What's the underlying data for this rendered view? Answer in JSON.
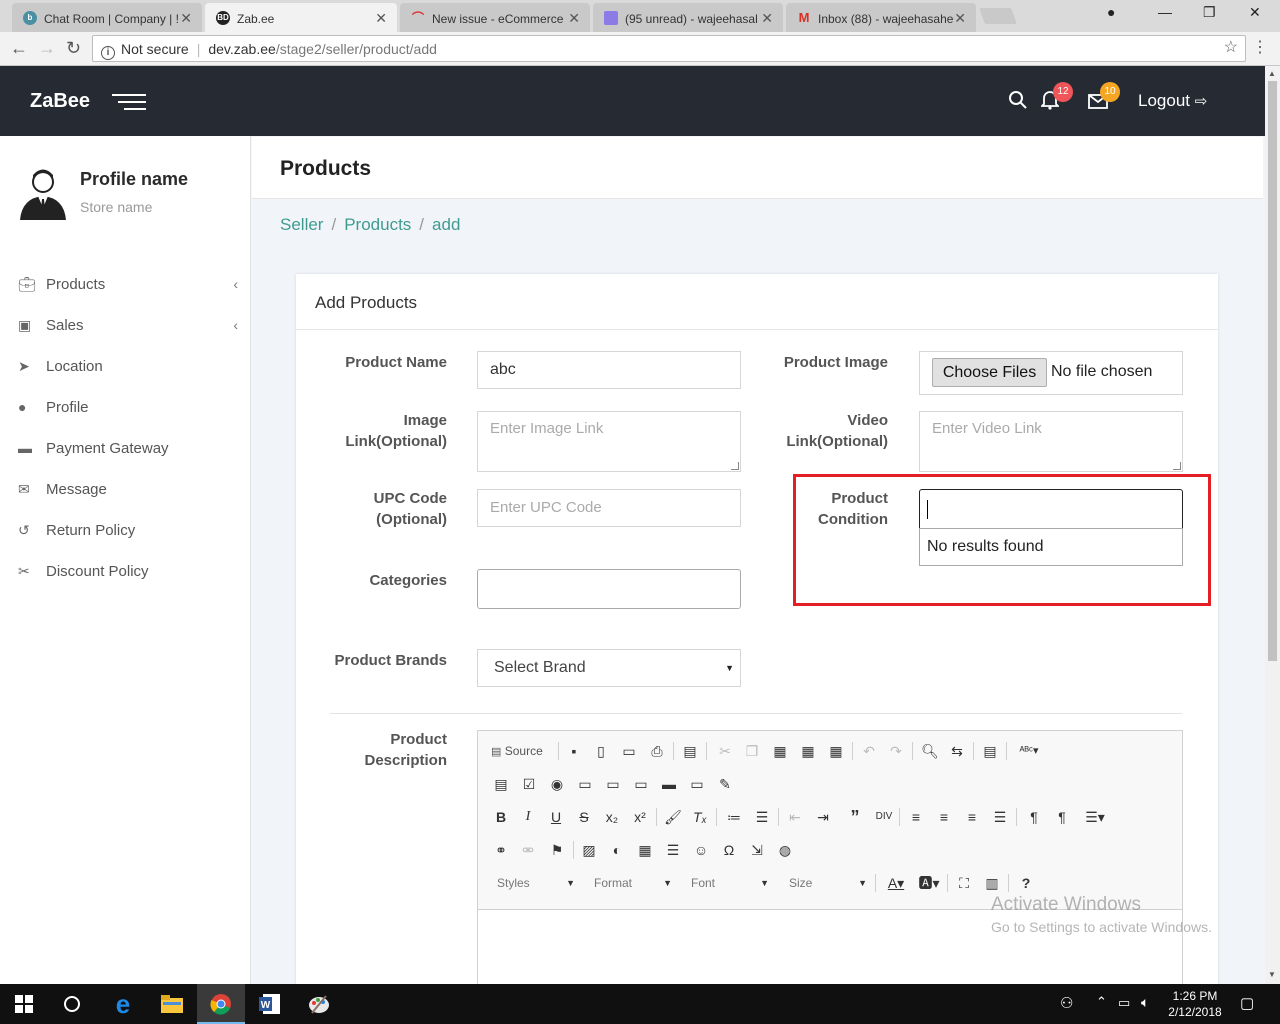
{
  "browser": {
    "tabs": [
      {
        "title": "Chat Room | Company | !",
        "fav": "b"
      },
      {
        "title": "Zab.ee",
        "fav": "BD"
      },
      {
        "title": "New issue - eCommerce",
        "fav": ""
      },
      {
        "title": "(95 unread) - wajeehasal",
        "fav": ""
      },
      {
        "title": "Inbox (88) - wajeehasahe",
        "fav": "M"
      }
    ],
    "security": "Not secure",
    "url_host": "dev.zab.ee",
    "url_path": "/stage2/seller/product/add"
  },
  "header": {
    "logo": "ZaBee",
    "notifications_count": "12",
    "messages_count": "10",
    "logout_label": "Logout"
  },
  "sidebar": {
    "profile_name": "Profile name",
    "store_name": "Store name",
    "items": [
      {
        "label": "Products",
        "icon": "briefcase-icon",
        "glyph": "▭",
        "caret": "‹"
      },
      {
        "label": "Sales",
        "icon": "money-icon",
        "glyph": "▣",
        "caret": "‹"
      },
      {
        "label": "Location",
        "icon": "location-arrow-icon",
        "glyph": "➤",
        "caret": ""
      },
      {
        "label": "Profile",
        "icon": "user-icon",
        "glyph": "●",
        "caret": ""
      },
      {
        "label": "Payment Gateway",
        "icon": "credit-card-icon",
        "glyph": "▬",
        "caret": ""
      },
      {
        "label": "Message",
        "icon": "envelope-icon",
        "glyph": "✉",
        "caret": ""
      },
      {
        "label": "Return Policy",
        "icon": "undo-icon",
        "glyph": "↺",
        "caret": ""
      },
      {
        "label": "Discount Policy",
        "icon": "scissors-icon",
        "glyph": "✂",
        "caret": ""
      }
    ]
  },
  "page": {
    "title": "Products",
    "breadcrumb": [
      "Seller",
      "Products",
      "add"
    ],
    "card_title": "Add Products"
  },
  "form": {
    "product_name_label": "Product Name",
    "product_name_value": "abc",
    "image_link_label_1": "Image",
    "image_link_label_2": "Link(Optional)",
    "image_link_placeholder": "Enter Image Link",
    "upc_label_1": "UPC Code",
    "upc_label_2": "(Optional)",
    "upc_placeholder": "Enter UPC Code",
    "categories_label": "Categories",
    "brands_label": "Product Brands",
    "brand_selected": "Select Brand",
    "product_image_label": "Product Image",
    "choose_files_label": "Choose Files",
    "no_file_text": "No file chosen",
    "video_link_label_1": "Video",
    "video_link_label_2": "Link(Optional)",
    "video_link_placeholder": "Enter Video Link",
    "condition_label_1": "Product",
    "condition_label_2": "Condition",
    "condition_value": "",
    "condition_no_results": "No results found",
    "description_label_1": "Product",
    "description_label_2": "Description"
  },
  "editor": {
    "source_label": "Source",
    "styles_label": "Styles",
    "format_label": "Format",
    "font_label": "Font",
    "size_label": "Size"
  },
  "watermark": {
    "line1": "Activate Windows",
    "line2": "Go to Settings to activate Windows."
  },
  "taskbar": {
    "time": "1:26 PM",
    "date": "2/12/2018"
  },
  "colors": {
    "accent": "#3f9b90",
    "header_bg": "#262b33",
    "highlight": "#e31e24",
    "badge_notif": "#f0555a",
    "badge_msg": "#f5a623"
  }
}
